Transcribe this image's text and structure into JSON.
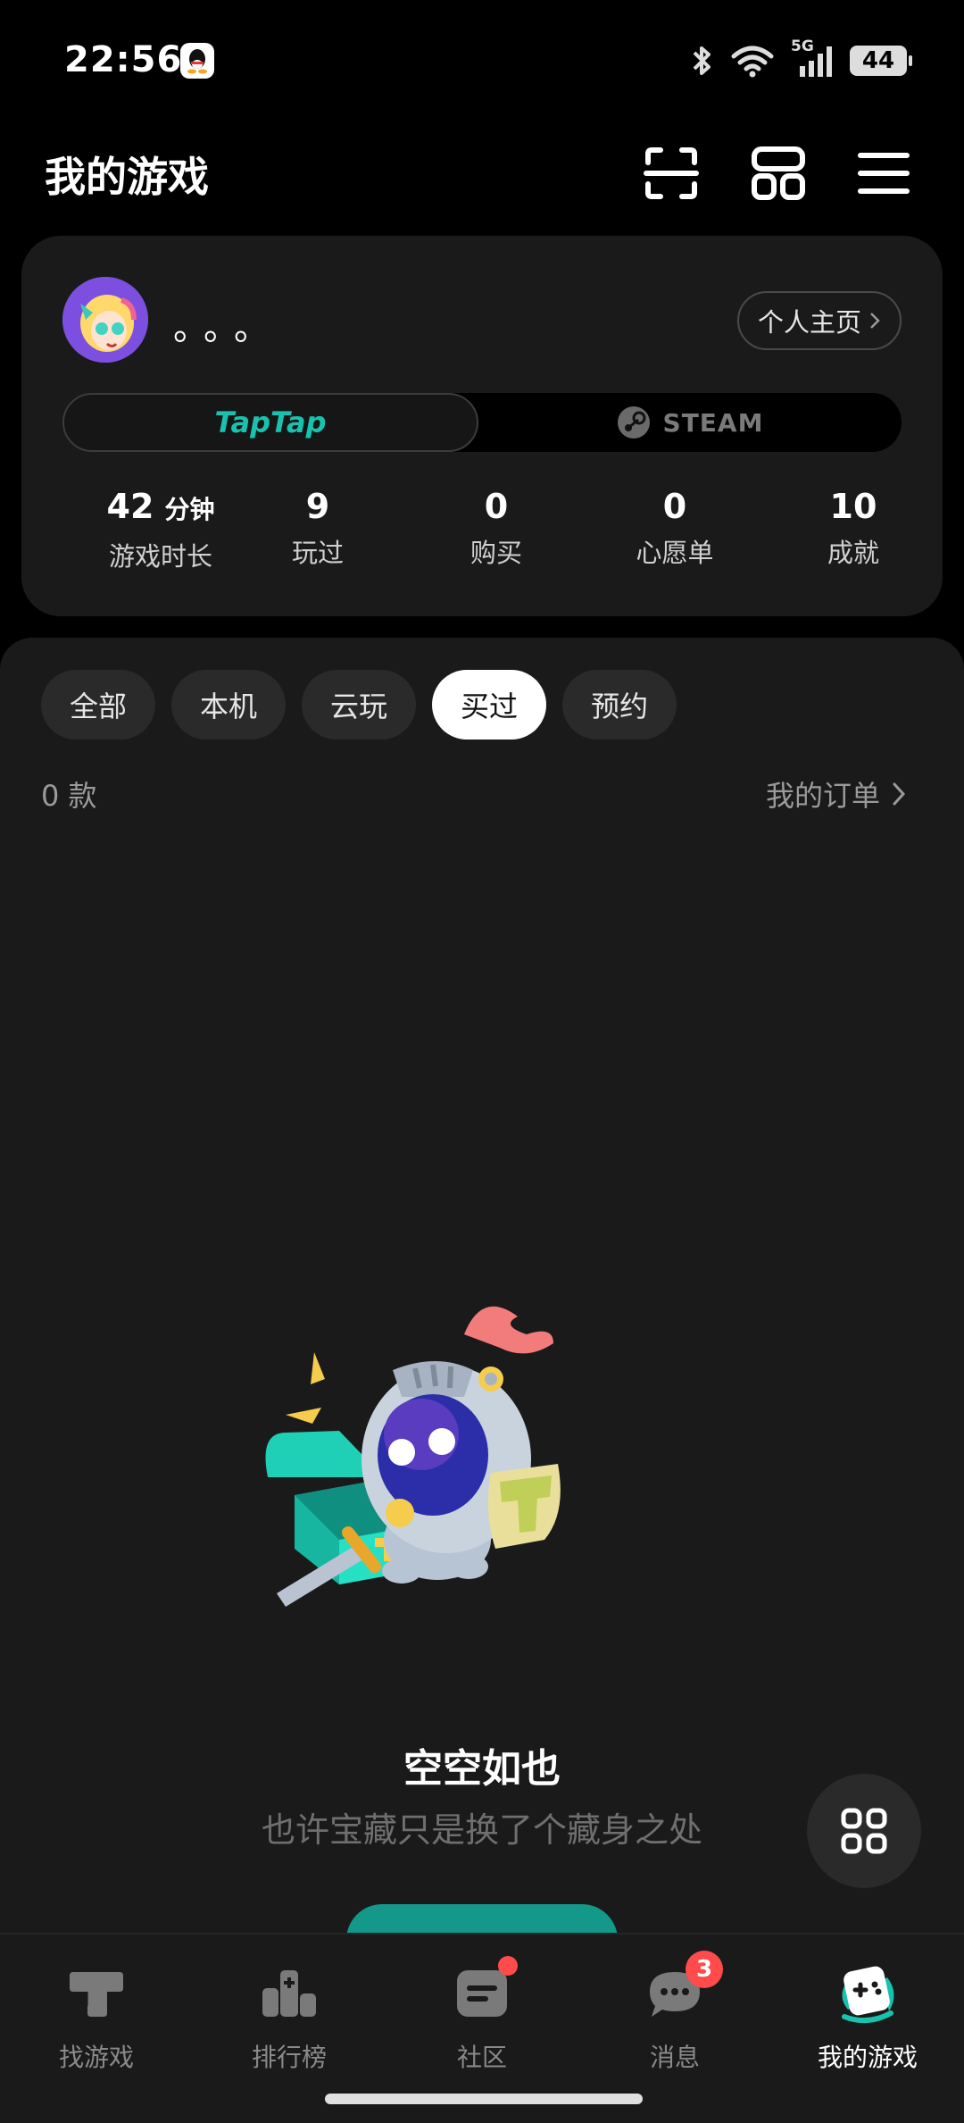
{
  "status_bar": {
    "time": "22:56",
    "network": "5G",
    "battery": "44"
  },
  "header": {
    "title": "我的游戏"
  },
  "profile": {
    "username": "。。。",
    "home_button": "个人主页",
    "platforms": {
      "taptap": "TapTap",
      "steam": "STEAM"
    },
    "stats": [
      {
        "value": "42",
        "unit": "分钟",
        "label": "游戏时长"
      },
      {
        "value": "9",
        "unit": "",
        "label": "玩过"
      },
      {
        "value": "0",
        "unit": "",
        "label": "购买"
      },
      {
        "value": "0",
        "unit": "",
        "label": "心愿单"
      },
      {
        "value": "10",
        "unit": "",
        "label": "成就"
      }
    ]
  },
  "filters": [
    {
      "label": "全部"
    },
    {
      "label": "本机"
    },
    {
      "label": "云玩"
    },
    {
      "label": "买过",
      "active": true
    },
    {
      "label": "预约"
    }
  ],
  "list_info": {
    "count": "0 款",
    "orders_link": "我的订单"
  },
  "empty_state": {
    "title": "空空如也",
    "subtitle": "也许宝藏只是换了个藏身之处"
  },
  "bottom_nav": [
    {
      "label": "找游戏",
      "icon": "find-games-icon"
    },
    {
      "label": "排行榜",
      "icon": "ranking-icon"
    },
    {
      "label": "社区",
      "icon": "community-icon",
      "dot": true
    },
    {
      "label": "消息",
      "icon": "messages-icon",
      "badge": "3"
    },
    {
      "label": "我的游戏",
      "icon": "my-games-icon",
      "active": true
    }
  ],
  "colors": {
    "accent": "#19c2ae",
    "badge": "#ff4b4b",
    "card": "#1a1a1a",
    "chip": "#2a2a2a"
  }
}
